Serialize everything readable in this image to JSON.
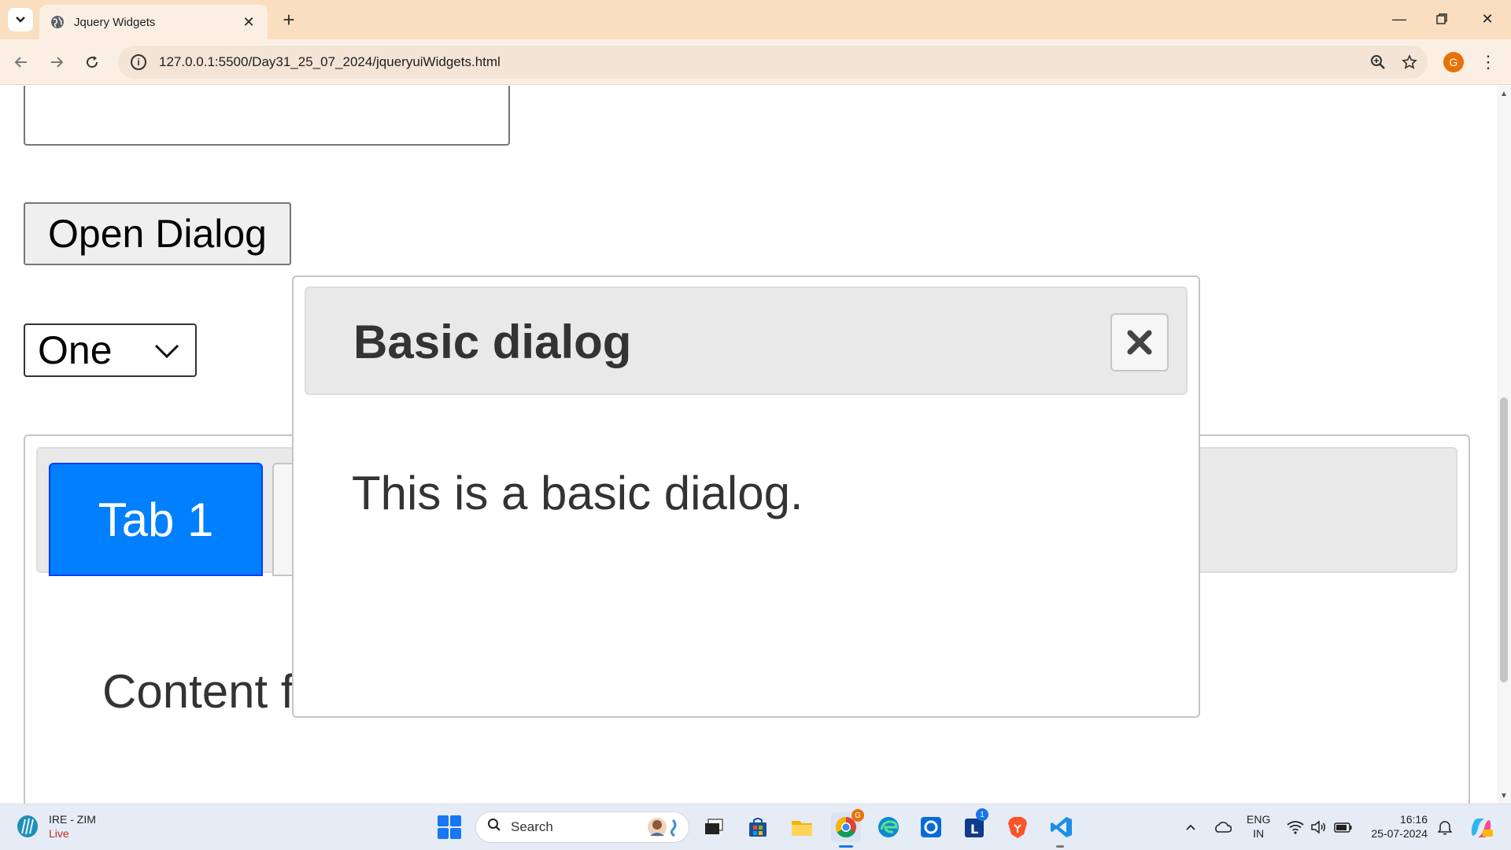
{
  "browser": {
    "tab_title": "Jquery Widgets",
    "url": "127.0.0.1:5500/Day31_25_07_2024/jqueryuiWidgets.html",
    "profile_initial": "G"
  },
  "page": {
    "open_dialog_label": "Open Dialog",
    "select_value": "One",
    "tabs": [
      {
        "label": "Tab 1",
        "active": true
      },
      {
        "label": "",
        "active": false
      }
    ],
    "tab_content": "Content for tab 1."
  },
  "dialog": {
    "title": "Basic dialog",
    "body": "This is a basic dialog."
  },
  "taskbar": {
    "weather_line1": "IRE - ZIM",
    "weather_line2": "Live",
    "search_label": "Search",
    "lang_line1": "ENG",
    "lang_line2": "IN",
    "time": "16:16",
    "date": "25-07-2024",
    "outlook_badge": "1",
    "chrome_badge": "G"
  },
  "colors": {
    "tab_active_bg": "#007fff",
    "chrome_tabstrip": "#f9dec0",
    "profile_avatar": "#e8710a"
  }
}
